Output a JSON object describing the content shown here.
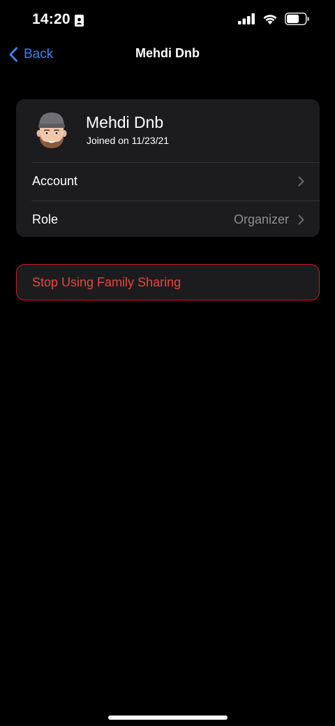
{
  "status_bar": {
    "time": "14:20",
    "icons": [
      "person-id-icon",
      "cellular-signal-icon",
      "wifi-icon",
      "battery-icon"
    ]
  },
  "nav": {
    "back_label": "Back",
    "title": "Mehdi Dnb"
  },
  "profile": {
    "name": "Mehdi Dnb",
    "joined": "Joined on 11/23/21"
  },
  "rows": [
    {
      "label": "Account",
      "value": ""
    },
    {
      "label": "Role",
      "value": "Organizer"
    }
  ],
  "stop_button": {
    "label": "Stop Using Family Sharing"
  },
  "colors": {
    "background": "#000000",
    "card": "#1c1c1e",
    "accent_blue": "#3b82f6",
    "destructive_red": "#e5483f",
    "secondary_text": "#8e8e93"
  }
}
